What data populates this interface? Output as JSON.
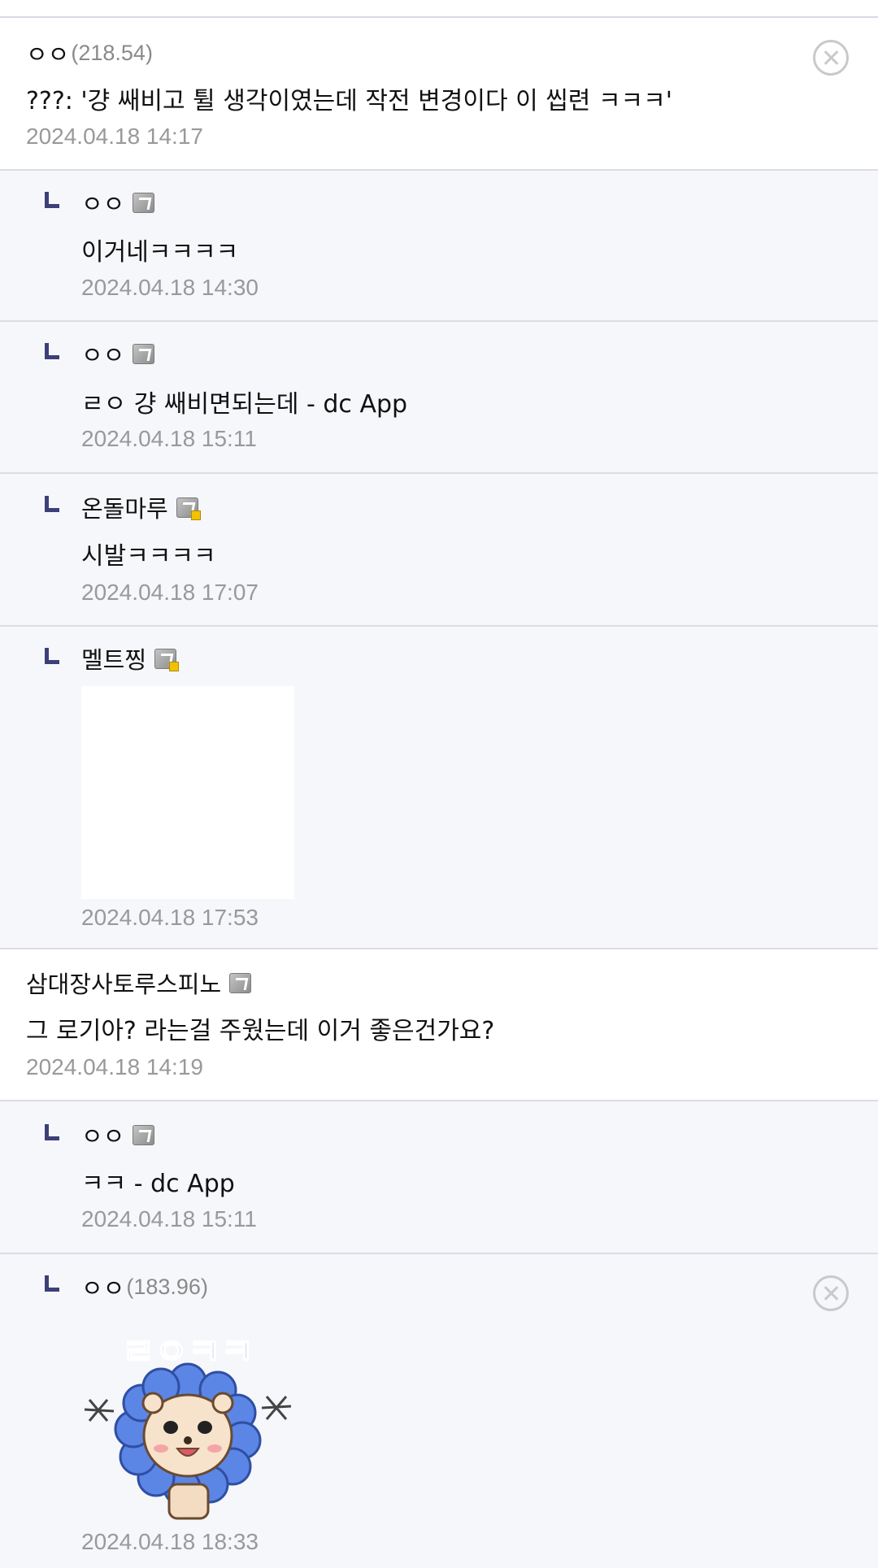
{
  "comments": [
    {
      "nick": "ㅇㅇ",
      "ip": "(218.54)",
      "text": "???: '걍 쌔비고 튈 생각이였는데 작전 변경이다 이 씹련 ㅋㅋㅋ'",
      "date": "2024.04.18 14:17"
    },
    {
      "nick": "ㅇㅇ",
      "text": "이거네ㅋㅋㅋㅋ",
      "date": "2024.04.18 14:30"
    },
    {
      "nick": "ㅇㅇ",
      "text": "ㄹㅇ 걍 쌔비면되는데 - dc App",
      "date": "2024.04.18 15:11"
    },
    {
      "nick": "온돌마루",
      "text": "시발ㅋㅋㅋㅋ",
      "date": "2024.04.18 17:07"
    },
    {
      "nick": "멜트찡",
      "date": "2024.04.18 17:53"
    },
    {
      "nick": "삼대장사토루스피노",
      "text": "그 로기아? 라는걸 주웠는데 이거 좋은건가요?",
      "date": "2024.04.18 14:19"
    },
    {
      "nick": "ㅇㅇ",
      "text": "ㅋㅋ - dc App",
      "date": "2024.04.18 15:11"
    },
    {
      "nick": "ㅇㅇ",
      "ip": "(183.96)",
      "sticker_text": "ㄹㅇㅋㅋ",
      "date": "2024.04.18 18:33"
    }
  ],
  "icons": {
    "member": "fixed-nick-icon",
    "member_gold": "gonik-icon",
    "delete": "delete-circle-x-icon",
    "reply": "reply-arrow-icon"
  },
  "colors": {
    "reply_bg": "#f6f7fb",
    "top_bg": "#ffffff",
    "reply_mark": "#3d3f78",
    "date": "#999999",
    "sticker_text": "#7b5be0",
    "sticker_petal": "#5b86e6"
  }
}
